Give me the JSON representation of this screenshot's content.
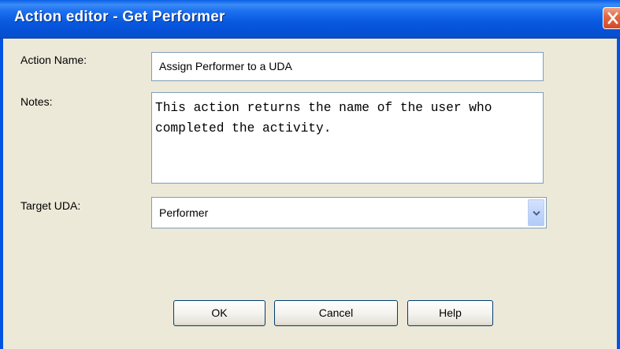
{
  "window": {
    "title": "Action editor - Get Performer"
  },
  "form": {
    "action_name": {
      "label": "Action Name:",
      "value": "Assign Performer to a UDA"
    },
    "notes": {
      "label": "Notes:",
      "value": "This action returns the name of the user who completed the activity."
    },
    "target_uda": {
      "label": "Target UDA:",
      "value": "Performer"
    }
  },
  "buttons": {
    "ok": "OK",
    "cancel": "Cancel",
    "help": "Help"
  },
  "icons": {
    "close": "close-icon",
    "dropdown": "chevron-down-icon"
  },
  "colors": {
    "titlebar": "#0858de",
    "window_bg": "#ece9d8",
    "close_button": "#d2492a",
    "field_border": "#7f9db9",
    "button_border": "#003c74"
  }
}
